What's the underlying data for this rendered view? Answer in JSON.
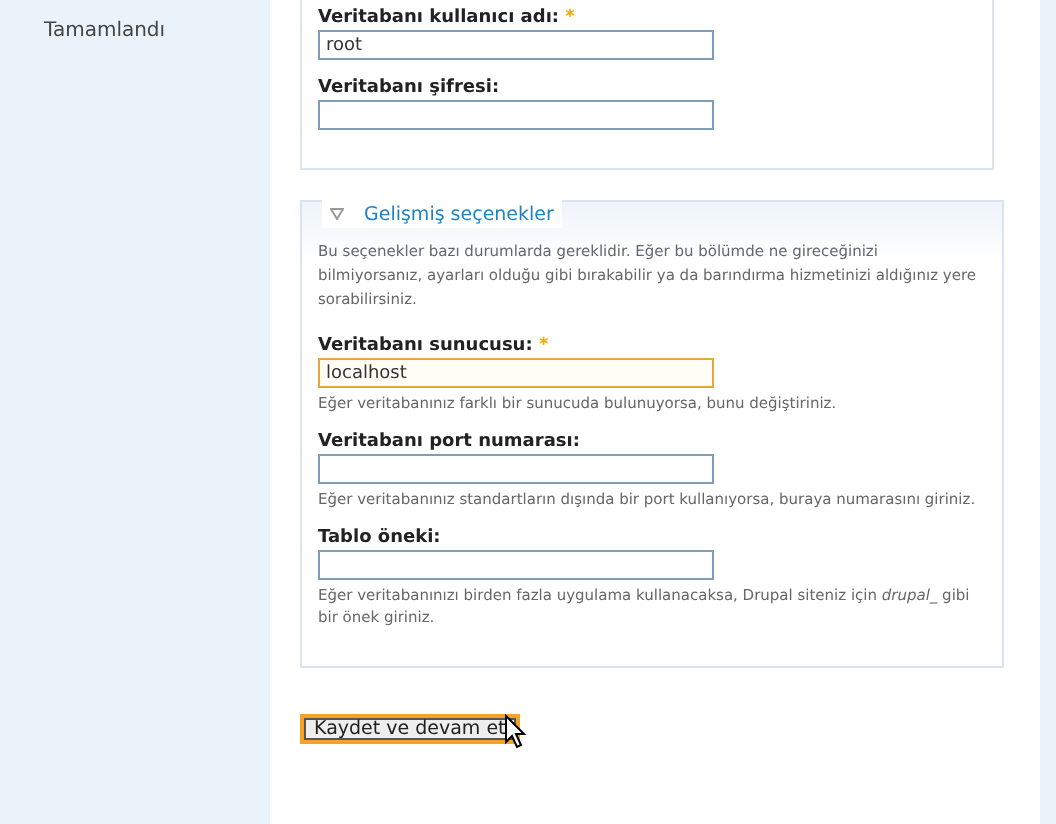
{
  "sidebar": {
    "items": [
      {
        "label": "Tamamlandı",
        "selected": false
      }
    ]
  },
  "database_fieldset": {
    "fields": [
      {
        "label": "Veritabanı kullanıcı adı:",
        "required_mark": "*",
        "value": "root",
        "focused": false
      },
      {
        "label": "Veritabanı şifresi:",
        "focused": false
      }
    ]
  },
  "advanced_fieldset": {
    "legend": "Gelişmiş seçenekler",
    "expanded": true,
    "intro": "Bu seçenekler bazı durumlarda gereklidir. Eğer bu bölümde ne gireceğinizi bilmiyorsanız, ayarları olduğu gibi bırakabilir ya da barındırma hizmetinizi aldığınız yere sorabilirsiniz.",
    "fields": [
      {
        "label": "Veritabanı sunucusu:",
        "required_mark": "*",
        "value": "localhost",
        "focused": true,
        "description": "Eğer veritabanınız farklı bir sunucuda bulunuyorsa, bunu değiştiriniz."
      },
      {
        "label": "Veritabanı port numarası:",
        "focused": false,
        "description": "Eğer veritabanınız standartların dışında bir port kullanıyorsa, buraya numarasını giriniz."
      },
      {
        "label": "Tablo öneki:",
        "focused": false,
        "description": "Eğer veritabanınızı birden fazla uygulama kullanacaksa, Drupal siteniz için *drupal_* gibi bir önek giriniz."
      }
    ]
  },
  "submit_button": {
    "label": "Kaydet ve devam et",
    "focused": true
  }
}
